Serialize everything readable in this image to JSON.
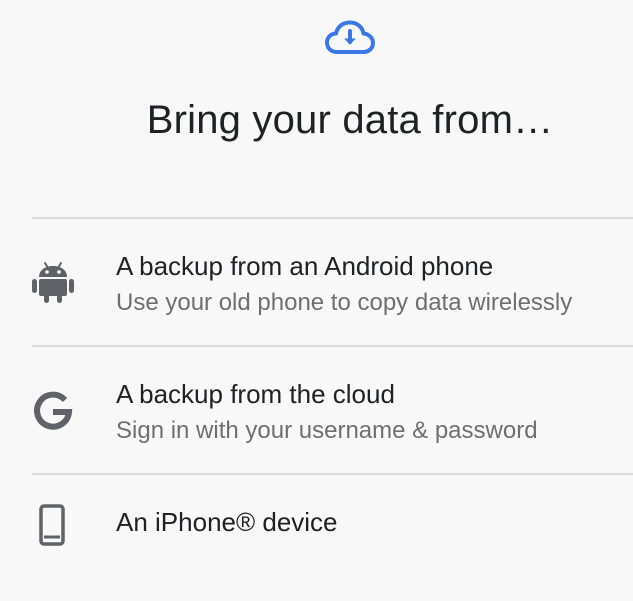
{
  "header": {
    "icon": "cloud-download-icon",
    "title": "Bring your data from…",
    "accent_color": "#3b78e7"
  },
  "options": [
    {
      "icon": "android-icon",
      "title": "A backup from an Android phone",
      "subtitle": "Use your old phone to copy data wirelessly"
    },
    {
      "icon": "google-g-icon",
      "title": "A backup from the cloud",
      "subtitle": "Sign in with your username & password"
    },
    {
      "icon": "phone-icon",
      "title": "An iPhone® device"
    }
  ],
  "icon_color": "#5f6368"
}
